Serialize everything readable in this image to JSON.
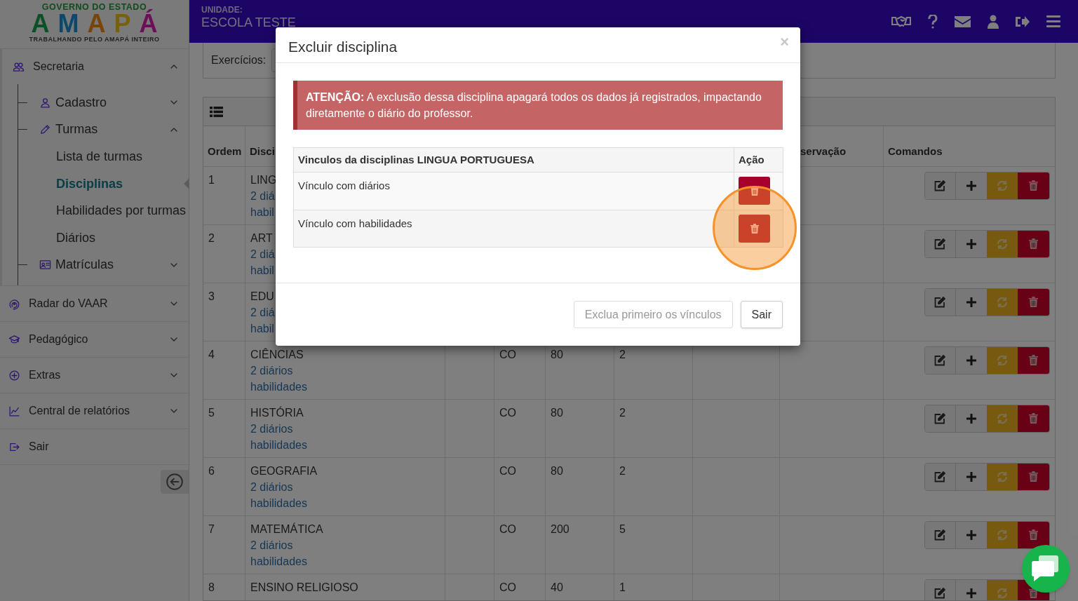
{
  "logo": {
    "top": "GOVERNO DO ESTADO",
    "wordmark": "AMAPÁ",
    "tagline": "TRABALHANDO PELO AMAPÁ INTEIRO"
  },
  "header": {
    "unit_label": "UNIDADE:",
    "unit_name": "ESCOLA TESTE"
  },
  "sidebar": {
    "items": [
      {
        "label": "Secretaria",
        "expanded": true,
        "children": [
          {
            "label": "Cadastro",
            "expanded": false
          },
          {
            "label": "Turmas",
            "expanded": true,
            "children": [
              {
                "label": "Lista de turmas",
                "selected": false
              },
              {
                "label": "Disciplinas",
                "selected": true
              },
              {
                "label": "Habilidades por turmas",
                "selected": false
              },
              {
                "label": "Diários",
                "selected": false
              }
            ]
          },
          {
            "label": "Matrículas",
            "expanded": false
          }
        ]
      },
      {
        "label": "Radar do VAAR",
        "expanded": false
      },
      {
        "label": "Pedagógico",
        "expanded": false
      },
      {
        "label": "Extras",
        "expanded": false
      },
      {
        "label": "Central de relatórios",
        "expanded": false
      },
      {
        "label": "Sair"
      }
    ]
  },
  "filter": {
    "label": "Exercícios:"
  },
  "table": {
    "headers": {
      "ordem": "Ordem",
      "disciplina": "Disci",
      "observacao": "servação",
      "comandos": "Comandos"
    },
    "rows": [
      {
        "order": "1",
        "name": "LING",
        "links": [
          "2 diá",
          "habil"
        ]
      },
      {
        "order": "2",
        "name": "ART",
        "links": [
          "2 diá",
          "habil"
        ]
      },
      {
        "order": "3",
        "name": "EDU",
        "links": [
          "2 diá",
          "habil"
        ]
      },
      {
        "order": "4",
        "name": "CIÊNCIAS",
        "links": [
          "2 diários",
          "habilidades"
        ],
        "column_4": "CO",
        "column_5": "80",
        "column_6": "2"
      },
      {
        "order": "5",
        "name": "HISTÓRIA",
        "links": [
          "2 diários",
          "habilidades"
        ],
        "column_4": "CO",
        "column_5": "80",
        "column_6": "2"
      },
      {
        "order": "6",
        "name": "GEOGRAFIA",
        "links": [
          "2 diários",
          "habilidades"
        ],
        "column_4": "CO",
        "column_5": "80",
        "column_6": "2"
      },
      {
        "order": "7",
        "name": "MATEMÁTICA",
        "links": [
          "2 diários",
          "habilidades"
        ],
        "column_4": "CO",
        "column_5": "200",
        "column_6": "5"
      },
      {
        "order": "8",
        "name": "ENSINO RELIGIOSO",
        "column_4": "CO",
        "column_5": "40",
        "column_6": "1"
      }
    ]
  },
  "modal": {
    "title": "Excluir disciplina",
    "close": "×",
    "alert": "**ATENÇÃO:** A exclusão dessa disciplina apagará todos os dados já registrados, impactando diretamente o diário do professor.",
    "links_table": {
      "header": "Vinculos da disciplinas LINGUA PORTUGUESA",
      "action_header": "Ação",
      "rows": [
        {
          "label": "Vínculo com diários",
          "highlighted": false
        },
        {
          "label": "Vínculo com habilidades",
          "highlighted": true
        }
      ]
    },
    "buttons": [
      {
        "label": "Exclua primeiro os vínculos",
        "disabled": true
      },
      {
        "label": "Sair",
        "disabled": false
      }
    ]
  }
}
